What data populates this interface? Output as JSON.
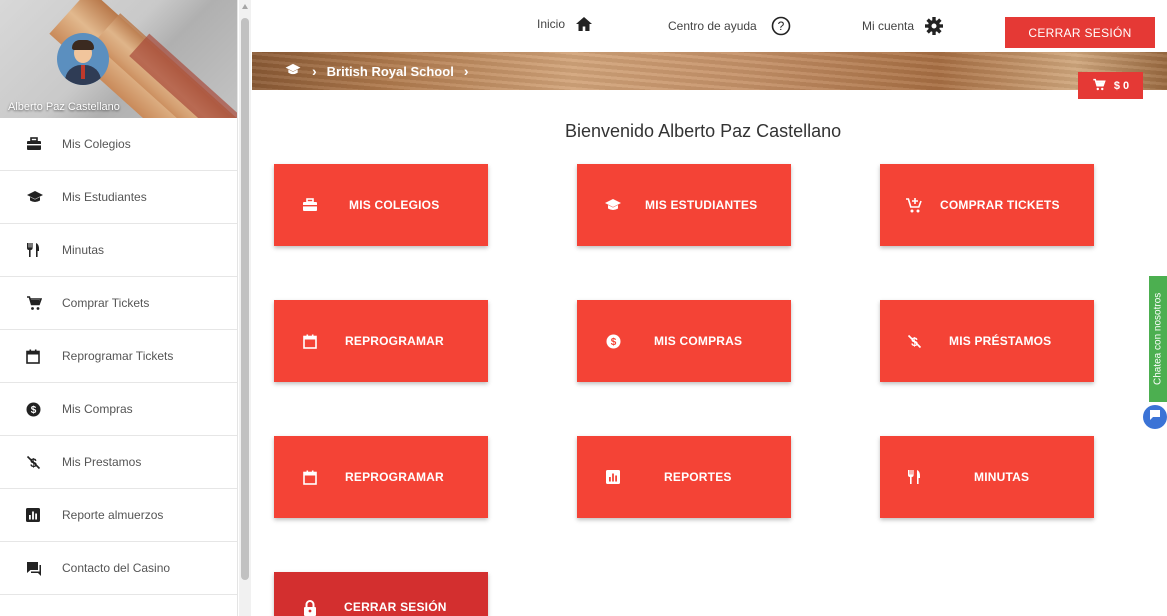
{
  "sidebar": {
    "profile_name": "Alberto Paz Castellano",
    "items": [
      {
        "label": "Mis Colegios",
        "icon": "briefcase-icon"
      },
      {
        "label": "Mis Estudiantes",
        "icon": "graduation-cap-icon"
      },
      {
        "label": "Minutas",
        "icon": "cutlery-icon"
      },
      {
        "label": "Comprar Tickets",
        "icon": "cart-icon"
      },
      {
        "label": "Reprogramar Tickets",
        "icon": "calendar-icon"
      },
      {
        "label": "Mis Compras",
        "icon": "dollar-circle-icon"
      },
      {
        "label": "Mis Prestamos",
        "icon": "money-off-icon"
      },
      {
        "label": "Reporte almuerzos",
        "icon": "bar-chart-icon"
      },
      {
        "label": "Contacto del Casino",
        "icon": "chat-icon"
      }
    ]
  },
  "topbar": {
    "home_label": "Inicio",
    "help_label": "Centro de ayuda",
    "account_label": "Mi cuenta",
    "logout_label": "CERRAR SESIÓN"
  },
  "breadcrumb": {
    "school": "British Royal School"
  },
  "cart": {
    "amount": "$ 0"
  },
  "welcome": "Bienvenido Alberto Paz Castellano",
  "tiles": [
    {
      "label": "MIS COLEGIOS",
      "icon": "briefcase-icon"
    },
    {
      "label": "MIS ESTUDIANTES",
      "icon": "graduation-cap-icon"
    },
    {
      "label": "COMPRAR TICKETS",
      "icon": "cart-plus-icon"
    },
    {
      "label": "REPROGRAMAR",
      "icon": "calendar-icon"
    },
    {
      "label": "MIS COMPRAS",
      "icon": "dollar-circle-icon"
    },
    {
      "label": "MIS PRÉSTAMOS",
      "icon": "money-off-icon"
    },
    {
      "label": "REPROGRAMAR",
      "icon": "calendar-icon"
    },
    {
      "label": "REPORTES",
      "icon": "bar-chart-icon"
    },
    {
      "label": "MINUTAS",
      "icon": "cutlery-icon"
    },
    {
      "label": "CERRAR SESIÓN",
      "icon": "lock-icon"
    }
  ],
  "chat": {
    "tab_label": "Chatea con nosotros"
  },
  "colors": {
    "primary_red": "#f44336",
    "dark_red": "#d32f2f",
    "chat_green": "#4caf50"
  }
}
